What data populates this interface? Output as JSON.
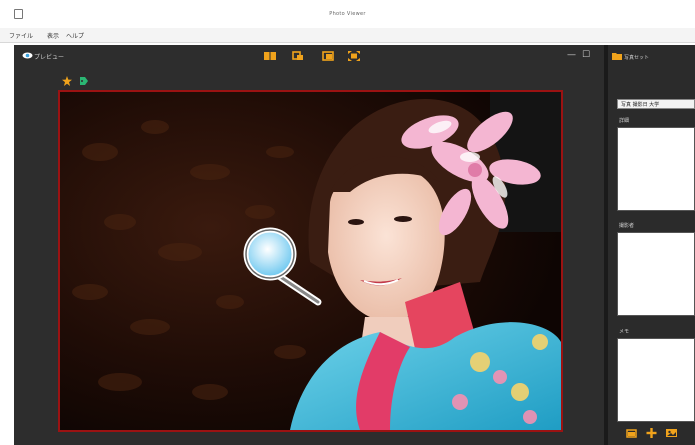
{
  "window": {
    "title": "Photo Viewer"
  },
  "menu": [
    {
      "label": "ファイル"
    },
    {
      "label": "表示"
    },
    {
      "label": "ヘルプ"
    }
  ],
  "preview": {
    "title": "プレビュー",
    "tools": [
      {
        "icon": "book-icon"
      },
      {
        "icon": "rotate-left-icon"
      },
      {
        "icon": "rotate-right-icon"
      },
      {
        "icon": "fullscreen-icon"
      }
    ],
    "window_controls": {
      "minimize": "—",
      "maximize": "☐"
    },
    "favorites": [
      {
        "icon": "star-icon"
      },
      {
        "icon": "tag-icon"
      }
    ],
    "cursor": {
      "icon": "magnifier-icon"
    }
  },
  "right_panel": {
    "title": "写真セット",
    "folder_field": "写真 撮影日 大学",
    "sections": [
      {
        "label": "詳細"
      },
      {
        "label": "撮影者"
      },
      {
        "label": "メモ"
      }
    ],
    "footer_icons": [
      {
        "icon": "folder-open-icon"
      },
      {
        "icon": "plus-icon"
      },
      {
        "icon": "photos-icon"
      }
    ]
  },
  "colors": {
    "accent": "#f0a31c",
    "frame_border": "#9b1212",
    "panel_bg": "#2d2d2d",
    "kimono": "#3fb8d8"
  }
}
